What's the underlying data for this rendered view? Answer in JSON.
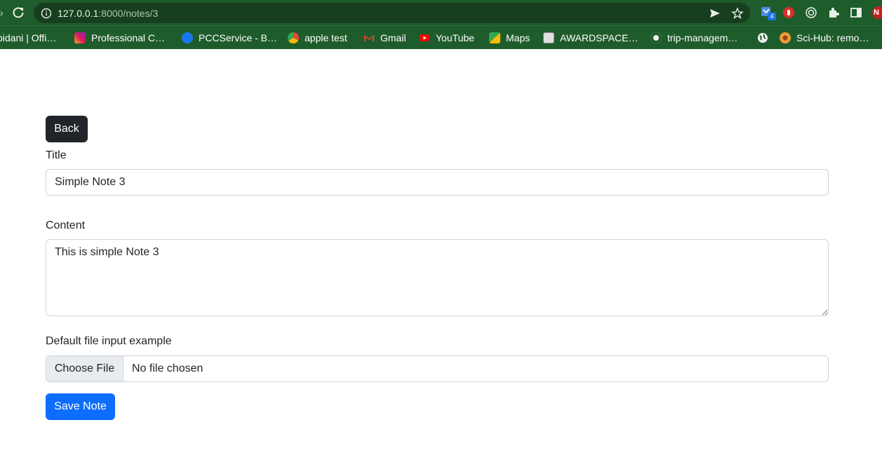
{
  "browser": {
    "url_host": "127.0.0.1",
    "url_path": ":8000/notes/3",
    "profile_initial": "N",
    "extension_badge": "4",
    "bookmarks": [
      {
        "label": "bidani | Offi…",
        "icon": "bookmark-partial"
      },
      {
        "label": "Professional C…",
        "icon": "instagram-icon"
      },
      {
        "label": "PCCService - B…",
        "icon": "facebook-icon"
      },
      {
        "label": "apple test",
        "icon": "chrome-icon"
      },
      {
        "label": "Gmail",
        "icon": "gmail-icon"
      },
      {
        "label": "YouTube",
        "icon": "youtube-icon"
      },
      {
        "label": "Maps",
        "icon": "maps-icon"
      },
      {
        "label": "AWARDSPACE…",
        "icon": "awardspace-icon"
      },
      {
        "label": "trip-managem…",
        "icon": "github-icon"
      },
      {
        "label": "",
        "icon": "globe-icon"
      },
      {
        "label": "Sci-Hub: remo…",
        "icon": "scihub-icon"
      }
    ]
  },
  "page": {
    "back_label": "Back",
    "title_label": "Title",
    "title_value": "Simple Note 3",
    "content_label": "Content",
    "content_value": "This is simple Note 3",
    "file_label": "Default file input example",
    "file_button": "Choose File",
    "file_status": "No file chosen",
    "save_label": "Save Note"
  },
  "colors": {
    "chrome_bg": "#1f5c2b",
    "save_button": "#0d6efd",
    "back_button": "#212529"
  }
}
